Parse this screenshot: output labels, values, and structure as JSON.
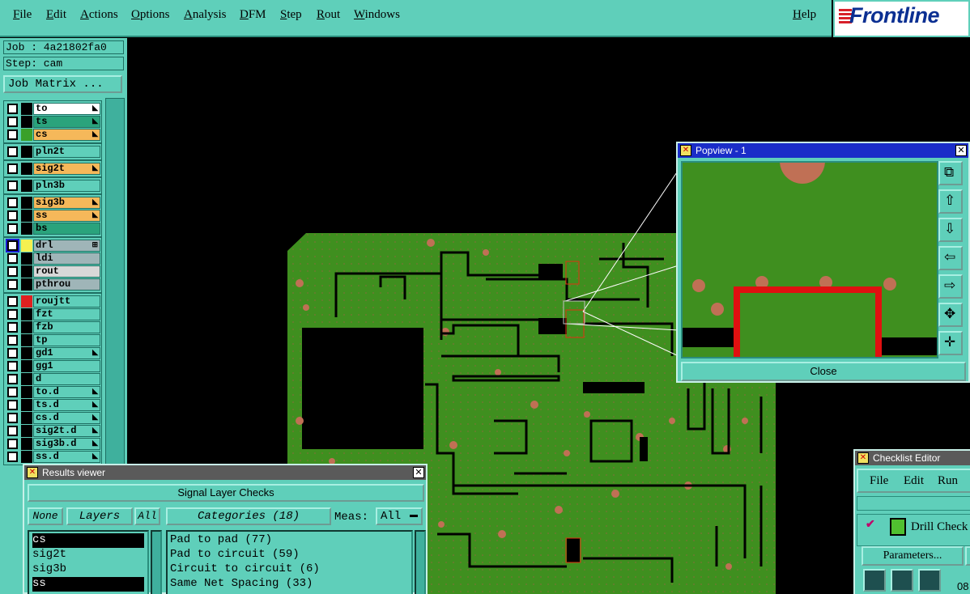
{
  "menubar": {
    "items": [
      "File",
      "Edit",
      "Actions",
      "Options",
      "Analysis",
      "DFM",
      "Step",
      "Rout",
      "Windows"
    ],
    "help": "Help",
    "logo": "Frontline"
  },
  "job": {
    "job_label": "Job : 4a21802fa0",
    "step_label": "Step: cam",
    "matrix_button": "Job Matrix ..."
  },
  "layers": [
    {
      "name": "to",
      "color": "#ffffff",
      "swatch": "#000000",
      "flag": "◣"
    },
    {
      "name": "ts",
      "color": "#2aa37c",
      "swatch": "#000000",
      "flag": "◣"
    },
    {
      "name": "cs",
      "color": "#f5b85a",
      "swatch": "#3aa02a",
      "flag": "◣"
    },
    {
      "name": "pln2t",
      "color": "#5fcfba",
      "swatch": "#000000",
      "flag": ""
    },
    {
      "name": "sig2t",
      "color": "#f5b85a",
      "swatch": "#000000",
      "flag": "◣"
    },
    {
      "name": "pln3b",
      "color": "#5fcfba",
      "swatch": "#000000",
      "flag": ""
    },
    {
      "name": "sig3b",
      "color": "#f5b85a",
      "swatch": "#000000",
      "flag": "◣"
    },
    {
      "name": "ss",
      "color": "#f5b85a",
      "swatch": "#000000",
      "flag": "◣"
    },
    {
      "name": "bs",
      "color": "#2aa37c",
      "swatch": "#000000",
      "flag": ""
    },
    {
      "name": "drl",
      "color": "#9fb5b8",
      "swatch": "#f5f050",
      "flag": "⊞"
    },
    {
      "name": "ldi",
      "color": "#9fb5b8",
      "swatch": "#000000",
      "flag": ""
    },
    {
      "name": "rout",
      "color": "#d8d8d8",
      "swatch": "#000000",
      "flag": ""
    },
    {
      "name": "pthrou",
      "color": "#9fb5b8",
      "swatch": "#000000",
      "flag": ""
    },
    {
      "name": "roujtt",
      "color": "#5fcfba",
      "swatch": "#e02020",
      "flag": ""
    },
    {
      "name": "fzt",
      "color": "#5fcfba",
      "swatch": "#000000",
      "flag": ""
    },
    {
      "name": "fzb",
      "color": "#5fcfba",
      "swatch": "#000000",
      "flag": ""
    },
    {
      "name": "tp",
      "color": "#5fcfba",
      "swatch": "#000000",
      "flag": ""
    },
    {
      "name": "gd1",
      "color": "#5fcfba",
      "swatch": "#000000",
      "flag": "◣"
    },
    {
      "name": "gg1",
      "color": "#5fcfba",
      "swatch": "#000000",
      "flag": ""
    },
    {
      "name": "d",
      "color": "#5fcfba",
      "swatch": "#000000",
      "flag": ""
    },
    {
      "name": "to.d",
      "color": "#5fcfba",
      "swatch": "#000000",
      "flag": "◣"
    },
    {
      "name": "ts.d",
      "color": "#5fcfba",
      "swatch": "#000000",
      "flag": "◣"
    },
    {
      "name": "cs.d",
      "color": "#5fcfba",
      "swatch": "#000000",
      "flag": "◣"
    },
    {
      "name": "sig2t.d",
      "color": "#5fcfba",
      "swatch": "#000000",
      "flag": "◣"
    },
    {
      "name": "sig3b.d",
      "color": "#5fcfba",
      "swatch": "#000000",
      "flag": "◣"
    },
    {
      "name": "ss.d",
      "color": "#5fcfba",
      "swatch": "#000000",
      "flag": "◣"
    }
  ],
  "results_viewer": {
    "title": "Results viewer",
    "header": "Signal Layer Checks",
    "none_label": "None",
    "layers_label": "Layers",
    "all_label": "All",
    "layer_items": [
      "cs",
      "sig2t",
      "sig3b",
      "ss"
    ],
    "selected_layers": [
      "cs",
      "ss"
    ],
    "categories_label": "Categories (18)",
    "meas_label": "Meas:",
    "meas_value": "All",
    "categories": [
      "Pad to pad (77)",
      "Pad to circuit (59)",
      "Circuit to circuit (6)",
      "Same Net Spacing (33)"
    ]
  },
  "popview": {
    "title": "Popview - 1",
    "close_label": "Close",
    "tools": [
      "zoom-fit-icon",
      "pan-up-icon",
      "pan-down-icon",
      "pan-left-icon",
      "pan-right-icon",
      "zoom-out-icon",
      "zoom-in-icon"
    ]
  },
  "checklist_editor": {
    "title": "Checklist Editor",
    "menu": [
      "File",
      "Edit",
      "Run"
    ],
    "item_label": "Drill Check",
    "parameters_button": "Parameters...",
    "counter": "08"
  },
  "colors": {
    "panel": "#5fcfba",
    "board": "#3f8f1f",
    "pad": "#c07055",
    "active_title": "#1a2dc8"
  }
}
